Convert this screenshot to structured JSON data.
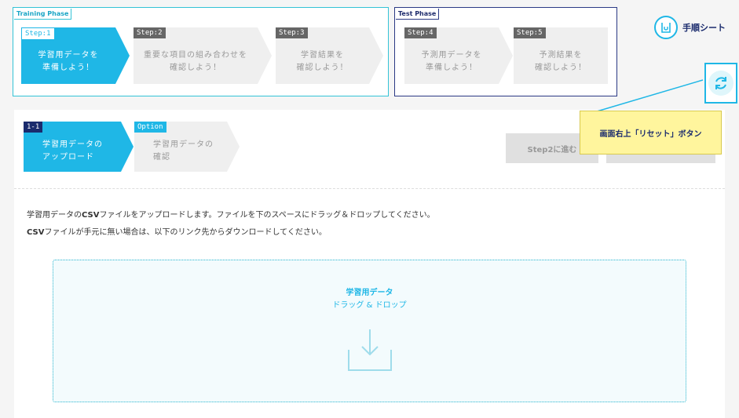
{
  "phases": {
    "training_label": "Training Phase",
    "test_label": "Test Phase"
  },
  "steps": [
    {
      "tag": "Step:1",
      "line1": "学習用データを",
      "line2": "準備しよう！"
    },
    {
      "tag": "Step:2",
      "line1": "重要な項目の組み合わせを",
      "line2": "確認しよう！"
    },
    {
      "tag": "Step:3",
      "line1": "学習結果を",
      "line2": "確認しよう！"
    },
    {
      "tag": "Step:4",
      "line1": "予測用データを",
      "line2": "準備しよう！"
    },
    {
      "tag": "Step:5",
      "line1": "予測結果を",
      "line2": "確認しよう！"
    }
  ],
  "manual": {
    "label": "手順シート",
    "icon": "manual-sheet-icon"
  },
  "reset": {
    "icon": "refresh-icon"
  },
  "callout": {
    "text": "画面右上「リセット」ボタン"
  },
  "substeps": [
    {
      "tag": "1-1",
      "line1": "学習用データの",
      "line2": "アップロード"
    },
    {
      "tag": "Option",
      "line1": "学習用データの",
      "line2": "確認"
    }
  ],
  "next_button": "Step2に進む",
  "description": {
    "line1_a": "学習用データの",
    "line1_b": "CSV",
    "line1_c": "ファイルをアップロードします。ファイルを下のスペースにドラッグ＆ドロップしてください。",
    "line2_a": "CSV",
    "line2_b": "ファイルが手元に無い場合は、以下のリンク先からダウンロードしてください。"
  },
  "dropzone": {
    "title": "学習用データ",
    "subtitle": "ドラッグ & ドロップ",
    "icon": "download-tray-icon"
  },
  "colors": {
    "accent": "#1fb7e6",
    "navy": "#1a2b6d",
    "callout": "#fff59d"
  }
}
